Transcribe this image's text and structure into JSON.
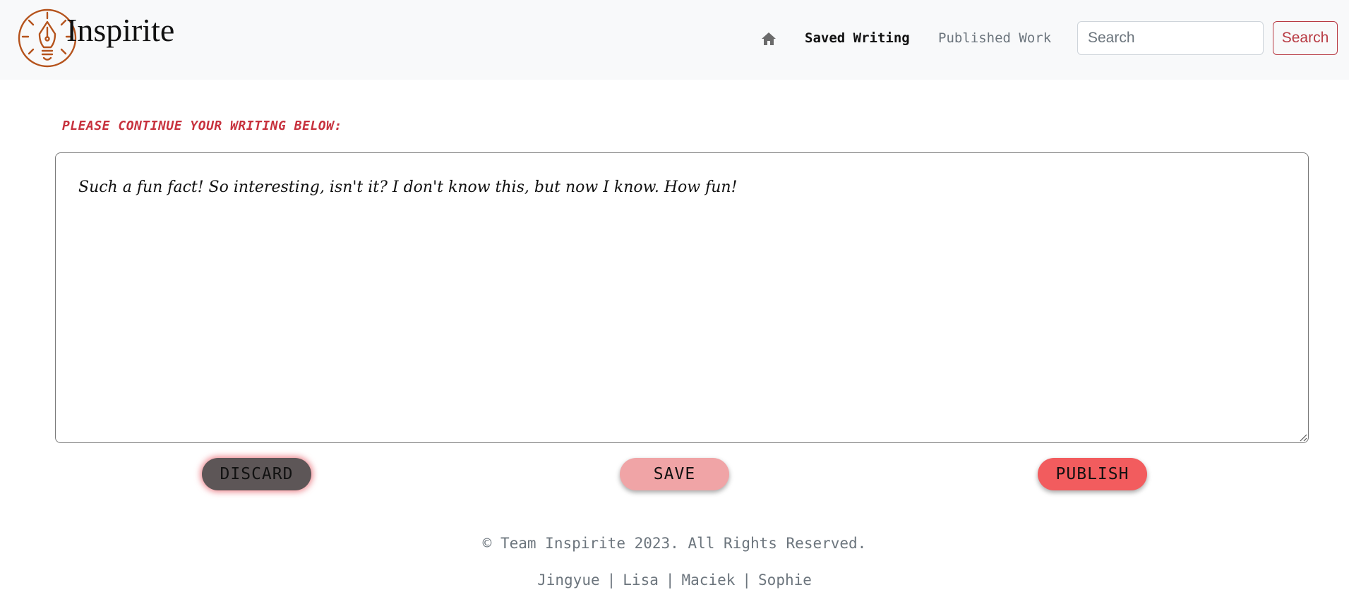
{
  "brand": {
    "name": "Inspirite",
    "logo_icon": "lightbulb-pen-nib-icon",
    "logo_color": "#b5531c"
  },
  "nav": {
    "home_icon": "home-icon",
    "saved_label": "Saved Writing",
    "published_label": "Published Work",
    "search_placeholder": "Search",
    "search_button_label": "Search"
  },
  "main": {
    "prompt": "PLEASE CONTINUE YOUR WRITING BELOW:",
    "writing_text": "Such a fun fact! So interesting, isn't it? I don't know this, but now I know. How fun!",
    "buttons": {
      "discard": "DISCARD",
      "save": "SAVE",
      "publish": "PUBLISH"
    }
  },
  "footer": {
    "copyright": "© Team Inspirite 2023. All Rights Reserved.",
    "members": [
      "Jingyue",
      "Lisa",
      "Maciek",
      "Sophie"
    ],
    "separator": "|"
  },
  "colors": {
    "accent_red": "#c7313d",
    "discard_bg": "#5d5657",
    "save_bg": "#f0a4a6",
    "publish_bg": "#f25c5e",
    "navbar_bg": "#f8f9fa"
  }
}
